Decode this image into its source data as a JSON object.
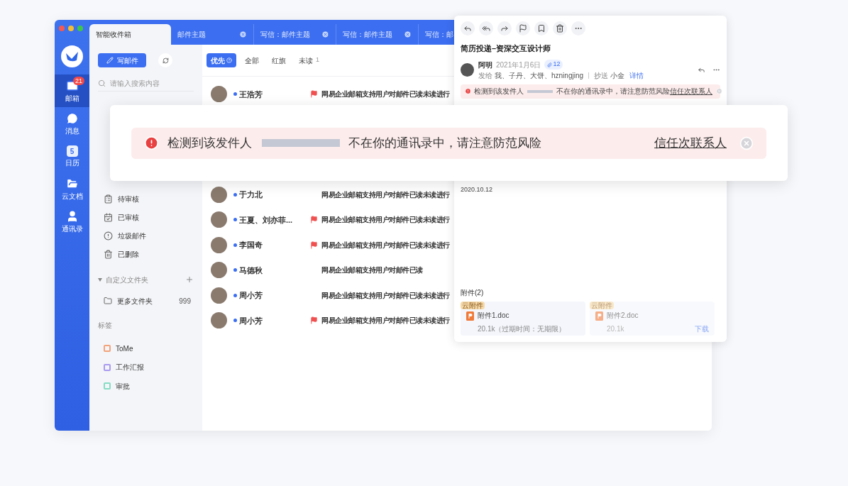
{
  "window_tabs": [
    {
      "label": "智能收件箱",
      "selected": true,
      "closable": false
    },
    {
      "label": "邮件主题",
      "selected": false,
      "closable": true
    },
    {
      "label": "写信：邮件主题",
      "selected": false,
      "closable": true
    },
    {
      "label": "写信：邮件主题",
      "selected": false,
      "closable": true
    },
    {
      "label": "写信：邮",
      "selected": false,
      "closable": false
    }
  ],
  "nav": [
    {
      "kind": "mail",
      "label": "邮箱",
      "selected": true,
      "badge": "21"
    },
    {
      "kind": "chat",
      "label": "消息",
      "selected": false
    },
    {
      "kind": "calendar",
      "label": "日历",
      "selected": false,
      "day": "5"
    },
    {
      "kind": "docs",
      "label": "云文档",
      "selected": false
    },
    {
      "kind": "contacts",
      "label": "通讯录",
      "selected": false
    }
  ],
  "compose_button": "写邮件",
  "search": {
    "placeholder": "请输入搜索内容"
  },
  "folders": [
    {
      "kind": "pending",
      "label": "待审核"
    },
    {
      "kind": "approved",
      "label": "已审核"
    },
    {
      "kind": "spam",
      "label": "垃圾邮件"
    },
    {
      "kind": "deleted",
      "label": "已删除"
    }
  ],
  "custom_folders": {
    "title": "自定义文件夹",
    "expanded": true,
    "items": [
      {
        "label": "更多文件夹",
        "count": "999"
      }
    ]
  },
  "tags": {
    "title": "标签",
    "items": [
      {
        "label": "ToMe",
        "color": "#f2a37c"
      },
      {
        "label": "工作汇报",
        "color": "#a99af0"
      },
      {
        "label": "审批",
        "color": "#86dcc4"
      }
    ]
  },
  "filters": [
    {
      "label": "优先",
      "selected": true,
      "help": true
    },
    {
      "label": "全部",
      "selected": false,
      "help": false
    },
    {
      "label": "红旗",
      "selected": false,
      "help": false
    },
    {
      "label": "未读",
      "selected": false,
      "help": false,
      "count": "1"
    }
  ],
  "mails_top": [
    {
      "sender": "王浩芳",
      "unread": true,
      "flagged": true,
      "preview": "网易企业邮箱支持用户对邮件已读未读进行"
    }
  ],
  "mails": [
    {
      "sender": "于力北",
      "unread": true,
      "flagged": false,
      "preview": "网易企业邮箱支持用户对邮件已读未读进行"
    },
    {
      "sender": "王夏、刘亦菲...",
      "unread": true,
      "flagged": true,
      "preview": "网易企业邮箱支持用户对邮件已读未读进行"
    },
    {
      "sender": "李国奇",
      "unread": true,
      "flagged": true,
      "preview": "网易企业邮箱支持用户对邮件已读未读进行"
    },
    {
      "sender": "马德秋",
      "unread": true,
      "flagged": false,
      "preview": "网易企业邮箱支持用户对邮件已读"
    },
    {
      "sender": "周小芳",
      "unread": true,
      "flagged": false,
      "preview": "网易企业邮箱支持用户对邮件已读未读进行"
    },
    {
      "sender": "周小芳",
      "unread": true,
      "flagged": true,
      "preview": "网易企业邮箱支持用户对邮件已读未读进行"
    }
  ],
  "reader": {
    "toolbar": [
      {
        "kind": "reply"
      },
      {
        "kind": "reply_all"
      },
      {
        "kind": "forward"
      },
      {
        "kind": "flag"
      },
      {
        "kind": "bookmark"
      },
      {
        "kind": "delete"
      },
      {
        "kind": "more"
      }
    ],
    "subject": "简历投递–资深交互设计师",
    "sender": "阿明",
    "date": "2021年1月6日",
    "attachment_count": "12",
    "to_label": "发给",
    "to": "我、子丹、大饼、hzningjing",
    "cc_label": "抄送",
    "cc": "小金",
    "details": "详情",
    "warning": {
      "before": "检测到该发件人",
      "after": "不在你的通讯录中，请注意防范风险",
      "link": "信任次联系人"
    },
    "body_date": "2020.10.12",
    "attachments_title": "附件(2)",
    "attachments": [
      {
        "badge": "云附件",
        "name": "附件1.doc",
        "meta": "20.1k（过期时间：无期限）",
        "faded": false
      },
      {
        "badge": "云附件",
        "name": "附件2.doc",
        "meta": "20.1k",
        "faded": true,
        "action": "下载"
      }
    ]
  },
  "banner": {
    "before": "检测到该发件人",
    "after": "不在你的通讯录中，请注意防范风险",
    "link": "信任次联系人"
  }
}
